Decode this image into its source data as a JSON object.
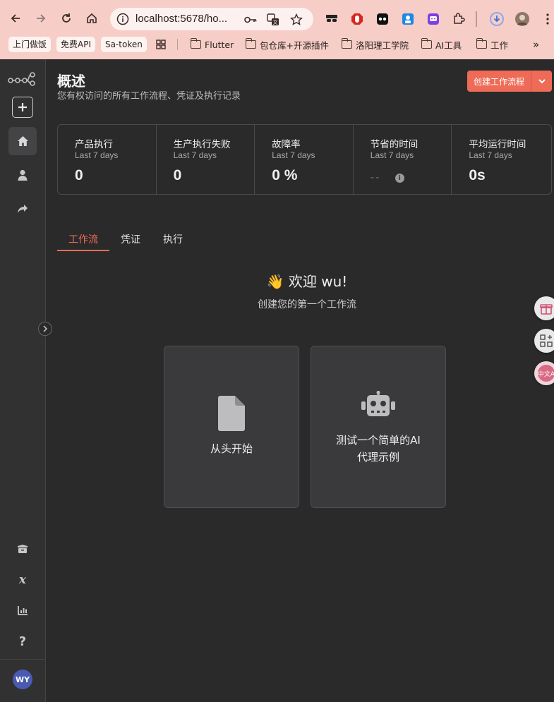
{
  "browser": {
    "url": "localhost:5678/ho...",
    "bookmarks": [
      "上门做饭",
      "免费API",
      "Sa-token"
    ],
    "folders": [
      "Flutter",
      "包仓库+开源插件",
      "洛阳理工学院",
      "AI工具",
      "工作"
    ]
  },
  "sidebar": {
    "avatar_initials": "WY"
  },
  "header": {
    "title": "概述",
    "subtitle": "您有权访问的所有工作流程、凭证及执行记录",
    "create_button": "创建工作流程"
  },
  "stats": [
    {
      "label": "产品执行",
      "period": "Last 7 days",
      "value": "0"
    },
    {
      "label": "生产执行失败",
      "period": "Last 7 days",
      "value": "0"
    },
    {
      "label": "故障率",
      "period": "Last 7 days",
      "value": "0 %"
    },
    {
      "label": "节省的时间",
      "period": "Last 7 days",
      "value": "--"
    },
    {
      "label": "平均运行时间",
      "period": "Last 7 days",
      "value": "0s"
    }
  ],
  "tabs": [
    "工作流",
    "凭证",
    "执行"
  ],
  "welcome": {
    "title": "👋 欢迎 wu!",
    "subtitle": "创建您的第一个工作流"
  },
  "cards": [
    {
      "label": "从头开始"
    },
    {
      "label_line1": "测试一个简单的AI",
      "label_line2": "代理示例"
    }
  ],
  "float_badges": {
    "translate": "中文A"
  },
  "colors": {
    "accent": "#ee6b57",
    "chrome": "#f6cdc7",
    "background": "#2a2a2b"
  }
}
